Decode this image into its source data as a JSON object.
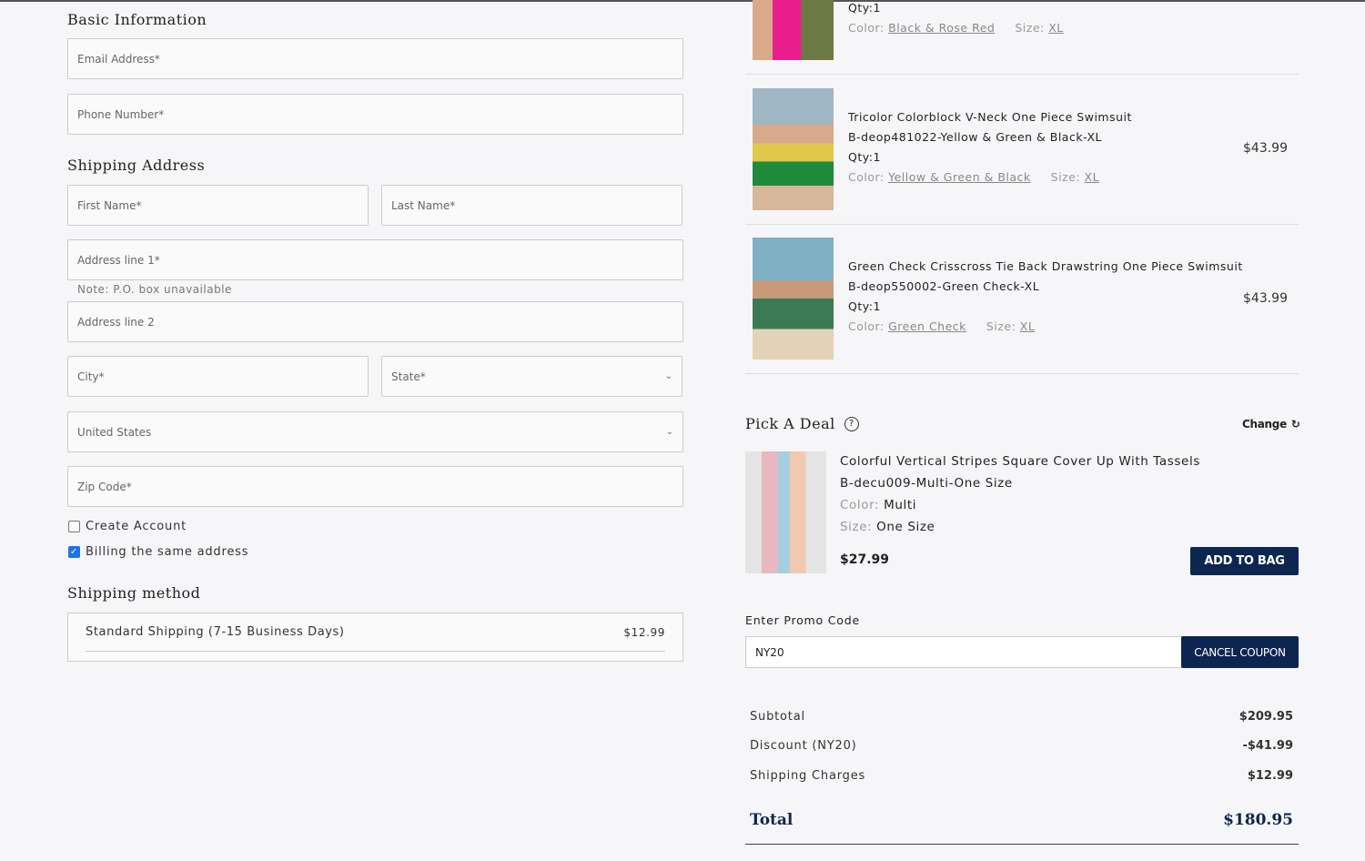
{
  "basic": {
    "title": "Basic Information",
    "email": "Email Address*",
    "phone": "Phone Number*"
  },
  "shipping": {
    "title": "Shipping Address",
    "first": "First Name*",
    "last": "Last Name*",
    "addr1": "Address line 1*",
    "note": "Note: P.O. box unavailable",
    "addr2": "Address line 2",
    "city": "City*",
    "state": "State*",
    "country": "United States",
    "zip": "Zip Code*"
  },
  "checks": {
    "create": "Create Account",
    "billing": "Billing the same address"
  },
  "method": {
    "title": "Shipping method",
    "name": "Standard Shipping (7-15 Business Days)",
    "price": "$12.99"
  },
  "items": [
    {
      "qty": "Qty:1",
      "color_label": "Color:",
      "color": "Black & Rose Red",
      "size_label": "Size:",
      "size": "XL"
    },
    {
      "name": "Tricolor Colorblock V-Neck One Piece Swimsuit",
      "sku": "B-deop481022-Yellow & Green & Black-XL",
      "qty": "Qty:1",
      "color_label": "Color:",
      "color": "Yellow & Green & Black",
      "size_label": "Size:",
      "size": "XL",
      "price": "$43.99"
    },
    {
      "name": "Green Check Crisscross Tie Back Drawstring One Piece Swimsuit",
      "sku": "B-deop550002-Green Check-XL",
      "qty": "Qty:1",
      "color_label": "Color:",
      "color": "Green Check",
      "size_label": "Size:",
      "size": "XL",
      "price": "$43.99"
    }
  ],
  "deal": {
    "title": "Pick A Deal",
    "change": "Change",
    "name": "Colorful Vertical Stripes Square Cover Up With Tassels",
    "sku": "B-decu009-Multi-One Size",
    "color_label": "Color:",
    "color": "Multi",
    "size_label": "Size:",
    "size": "One Size",
    "price": "$27.99",
    "add": "ADD TO BAG"
  },
  "promo": {
    "label": "Enter Promo Code",
    "value": "NY20",
    "cancel": "CANCEL COUPON"
  },
  "summary": {
    "subtotal_label": "Subtotal",
    "subtotal": "$209.95",
    "discount_label": "Discount (NY20)",
    "discount": "-$41.99",
    "shipping_label": "Shipping Charges",
    "shipping": "$12.99",
    "total_label": "Total",
    "total": "$180.95"
  },
  "colors": {
    "accent": "#0d2650"
  }
}
